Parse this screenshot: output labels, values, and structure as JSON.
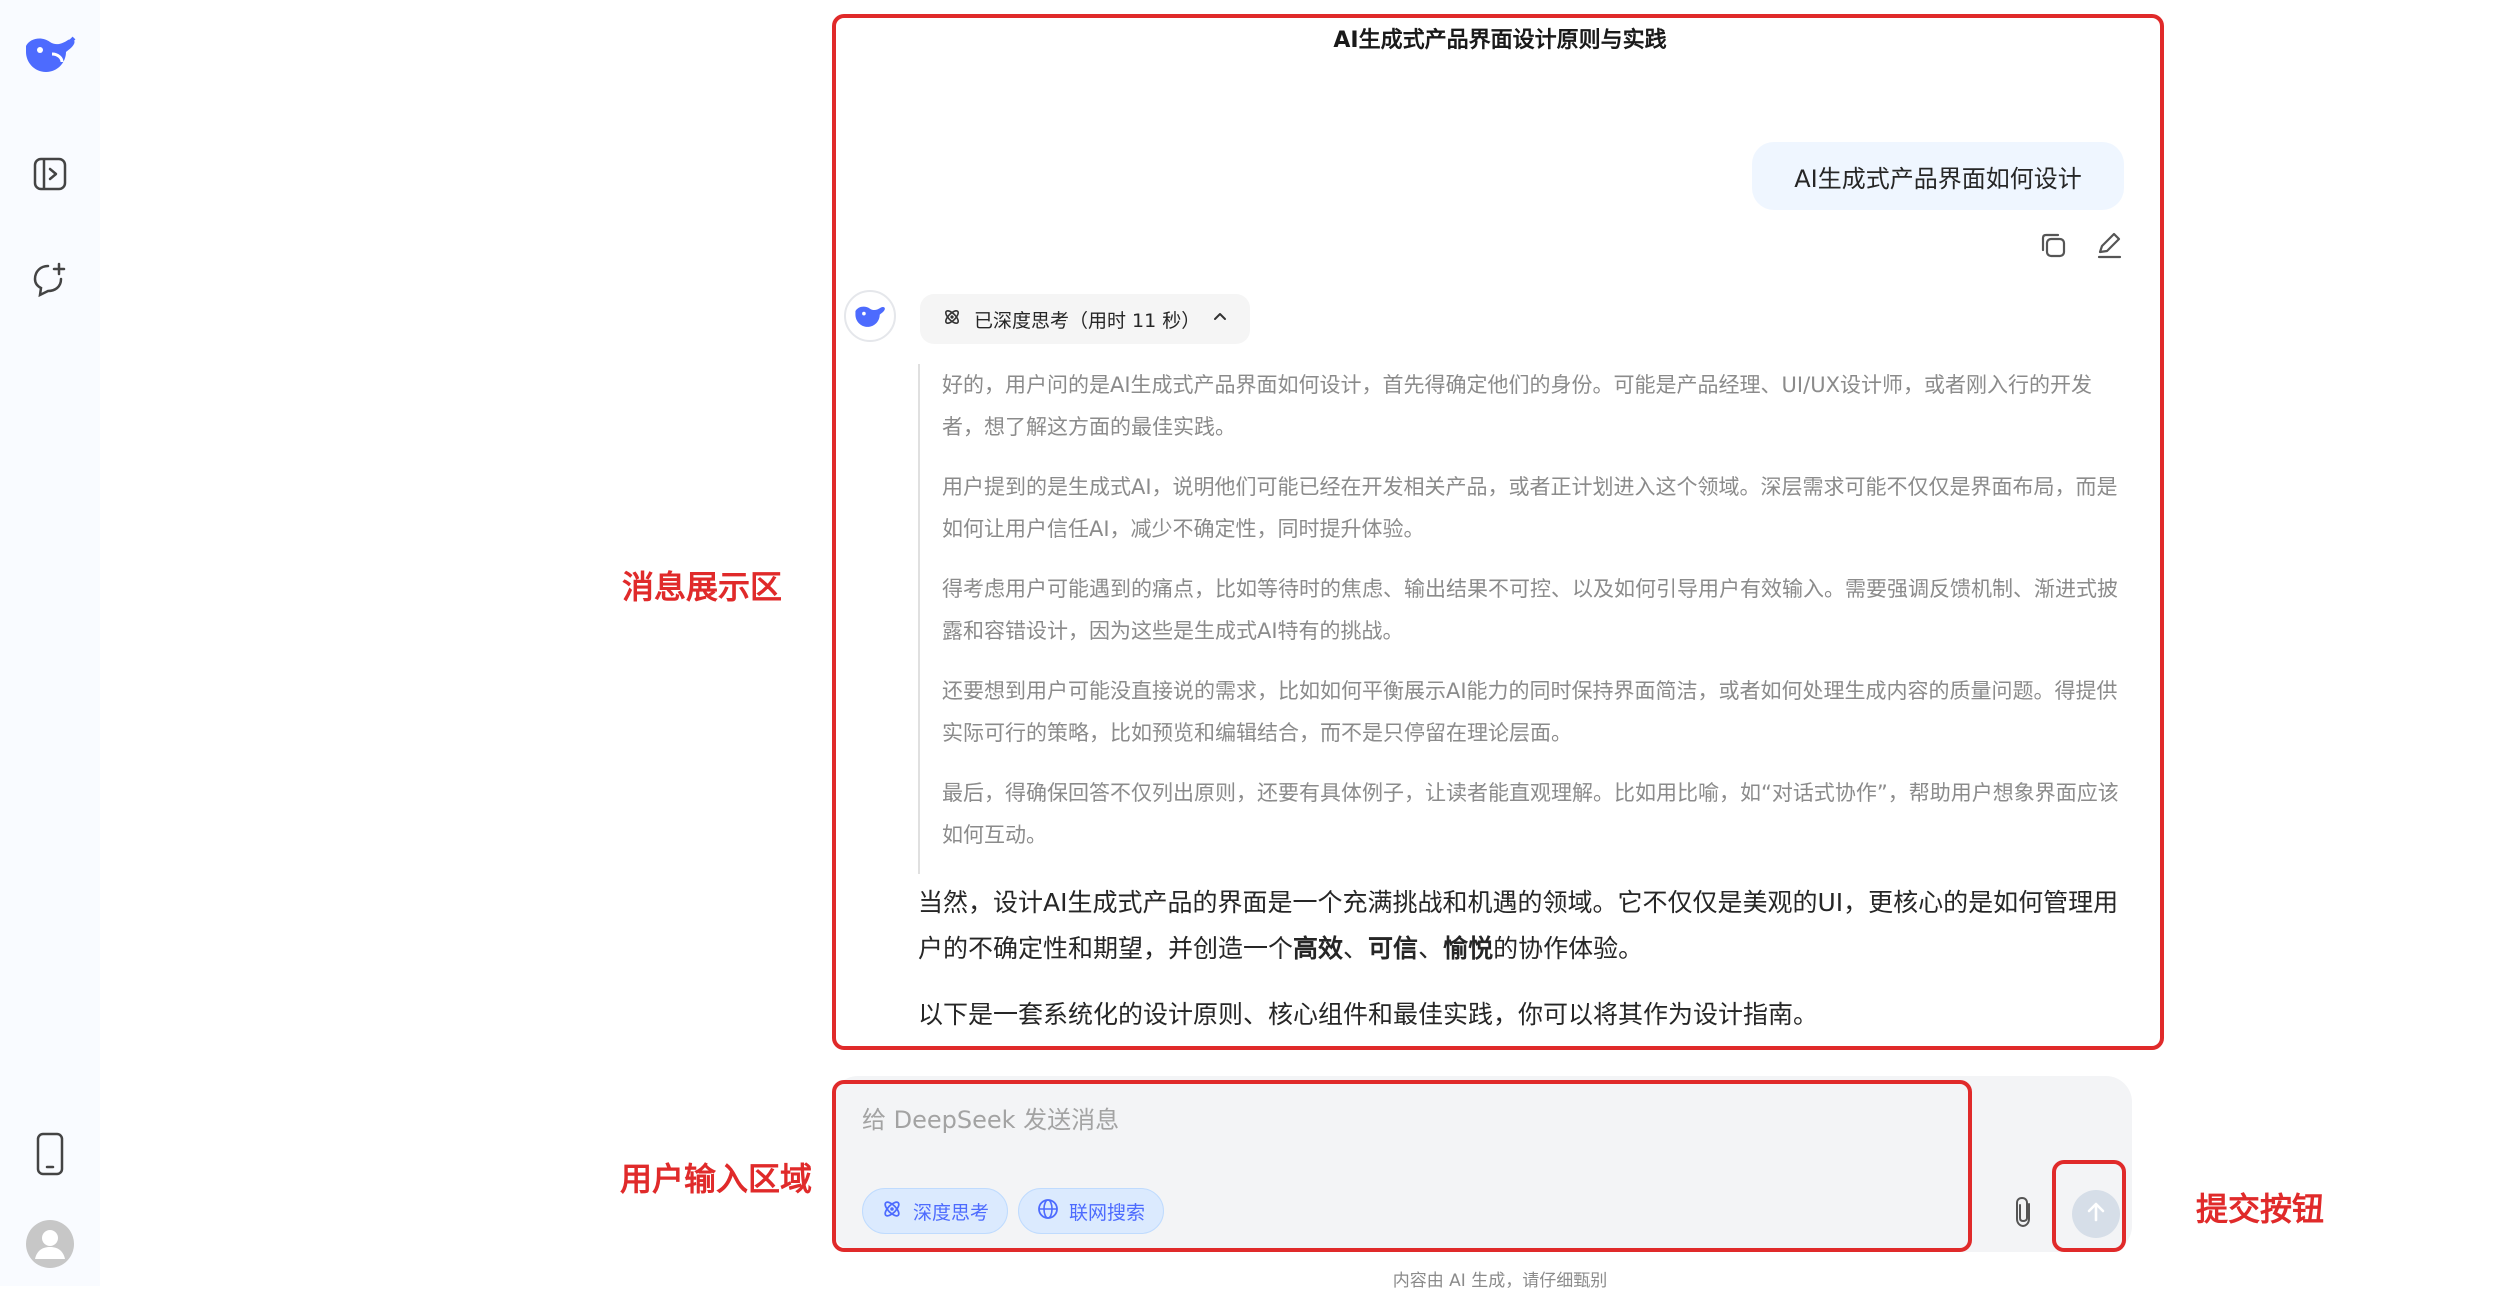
{
  "sidebar": {
    "icons": [
      "deepseek-logo",
      "open-sidebar",
      "new-chat",
      "mobile-app",
      "user-avatar"
    ]
  },
  "chat": {
    "title": "AI生成式产品界面设计原则与实践",
    "user_message": "AI生成式产品界面如何设计",
    "thinking_label": "已深度思考（用时 11 秒）",
    "thoughts": [
      "好的，用户问的是AI生成式产品界面如何设计，首先得确定他们的身份。可能是产品经理、UI/UX设计师，或者刚入行的开发者，想了解这方面的最佳实践。",
      "用户提到的是生成式AI，说明他们可能已经在开发相关产品，或者正计划进入这个领域。深层需求可能不仅仅是界面布局，而是如何让用户信任AI，减少不确定性，同时提升体验。",
      "得考虑用户可能遇到的痛点，比如等待时的焦虑、输出结果不可控、以及如何引导用户有效输入。需要强调反馈机制、渐进式披露和容错设计，因为这些是生成式AI特有的挑战。",
      "还要想到用户可能没直接说的需求，比如如何平衡展示AI能力的同时保持界面简洁，或者如何处理生成内容的质量问题。得提供实际可行的策略，比如预览和编辑结合，而不是只停留在理论层面。",
      "最后，得确保回答不仅列出原则，还要有具体例子，让读者能直观理解。比如用比喻，如“对话式协作”，帮助用户想象界面应该如何互动。"
    ],
    "answer_p1_a": "当然，设计AI生成式产品的界面是一个充满挑战和机遇的领域。它不仅仅是美观的UI，更核心的是如何管理用户的不确定性和期望，并创造一个",
    "answer_p1_b1": "高效",
    "answer_p1_sep1": "、",
    "answer_p1_b2": "可信",
    "answer_p1_sep2": "、",
    "answer_p1_b3": "愉悦",
    "answer_p1_c": "的协作体验。",
    "answer_p2": "以下是一套系统化的设计原则、核心组件和最佳实践，你可以将其作为设计指南。"
  },
  "input": {
    "placeholder": "给 DeepSeek 发送消息",
    "deep_think_label": "深度思考",
    "web_search_label": "联网搜索"
  },
  "footer": {
    "disclaimer": "内容由 AI 生成，请仔细甄别"
  },
  "annotations": {
    "message_area": "消息展示区",
    "input_area": "用户输入区域",
    "submit_button": "提交按钮"
  },
  "colors": {
    "brand": "#4d6bfe",
    "annotation": "#e02a2a",
    "sidebar_bg": "#f9fbff",
    "user_bubble": "#eff6ff"
  }
}
